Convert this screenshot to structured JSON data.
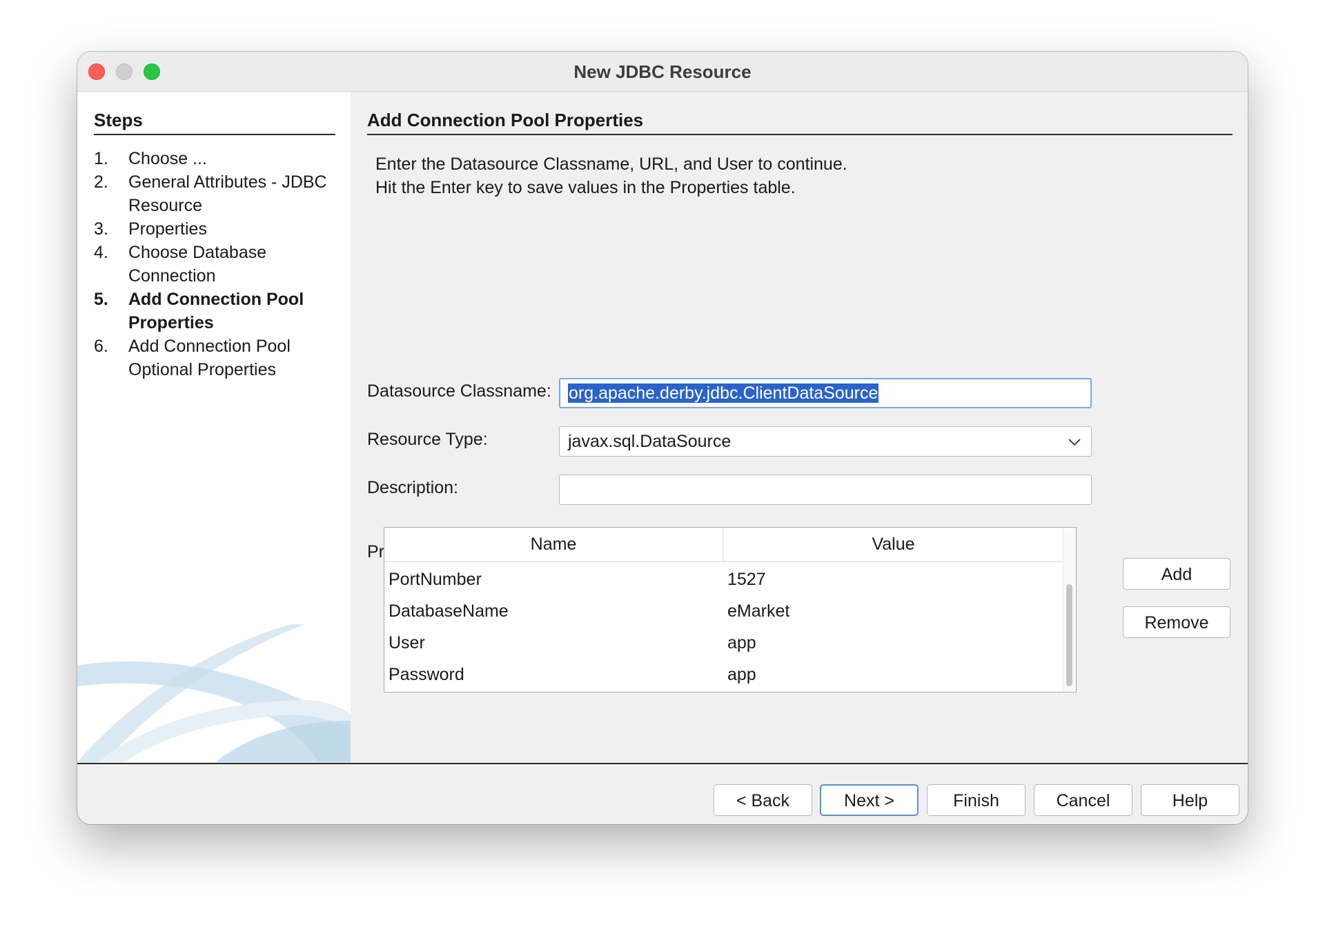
{
  "window": {
    "title": "New JDBC Resource"
  },
  "steps": {
    "header": "Steps",
    "items": [
      {
        "num": "1.",
        "label": "Choose ...",
        "current": false
      },
      {
        "num": "2.",
        "label": "General Attributes - JDBC Resource",
        "current": false
      },
      {
        "num": "3.",
        "label": "Properties",
        "current": false
      },
      {
        "num": "4.",
        "label": "Choose Database Connection",
        "current": false
      },
      {
        "num": "5.",
        "label": "Add Connection Pool Properties",
        "current": true
      },
      {
        "num": "6.",
        "label": "Add Connection Pool Optional Properties",
        "current": false
      }
    ]
  },
  "content": {
    "title": "Add Connection Pool Properties",
    "instruction_1": "Enter the Datasource Classname, URL, and User to continue.",
    "instruction_2": "Hit the Enter key to save values in the Properties table.",
    "datasource_label": "Datasource Classname:",
    "datasource_value": "org.apache.derby.jdbc.ClientDataSource",
    "resource_type_label": "Resource Type:",
    "resource_type_value": "javax.sql.DataSource",
    "description_label": "Description:",
    "description_value": "",
    "properties_label": "Properties:",
    "table": {
      "headers": [
        "Name",
        "Value"
      ],
      "rows": [
        [
          "PortNumber",
          "1527"
        ],
        [
          "DatabaseName",
          "eMarket"
        ],
        [
          "User",
          "app"
        ],
        [
          "Password",
          "app"
        ]
      ]
    },
    "add_label": "Add",
    "remove_label": "Remove"
  },
  "footer": {
    "back_label": "< Back",
    "next_label": "Next >",
    "finish_label": "Finish",
    "cancel_label": "Cancel",
    "help_label": "Help"
  },
  "colors": {
    "selection": "#2a63c9",
    "focus_border": "#7aa7e0",
    "default_button_border": "#5b8fd6"
  }
}
